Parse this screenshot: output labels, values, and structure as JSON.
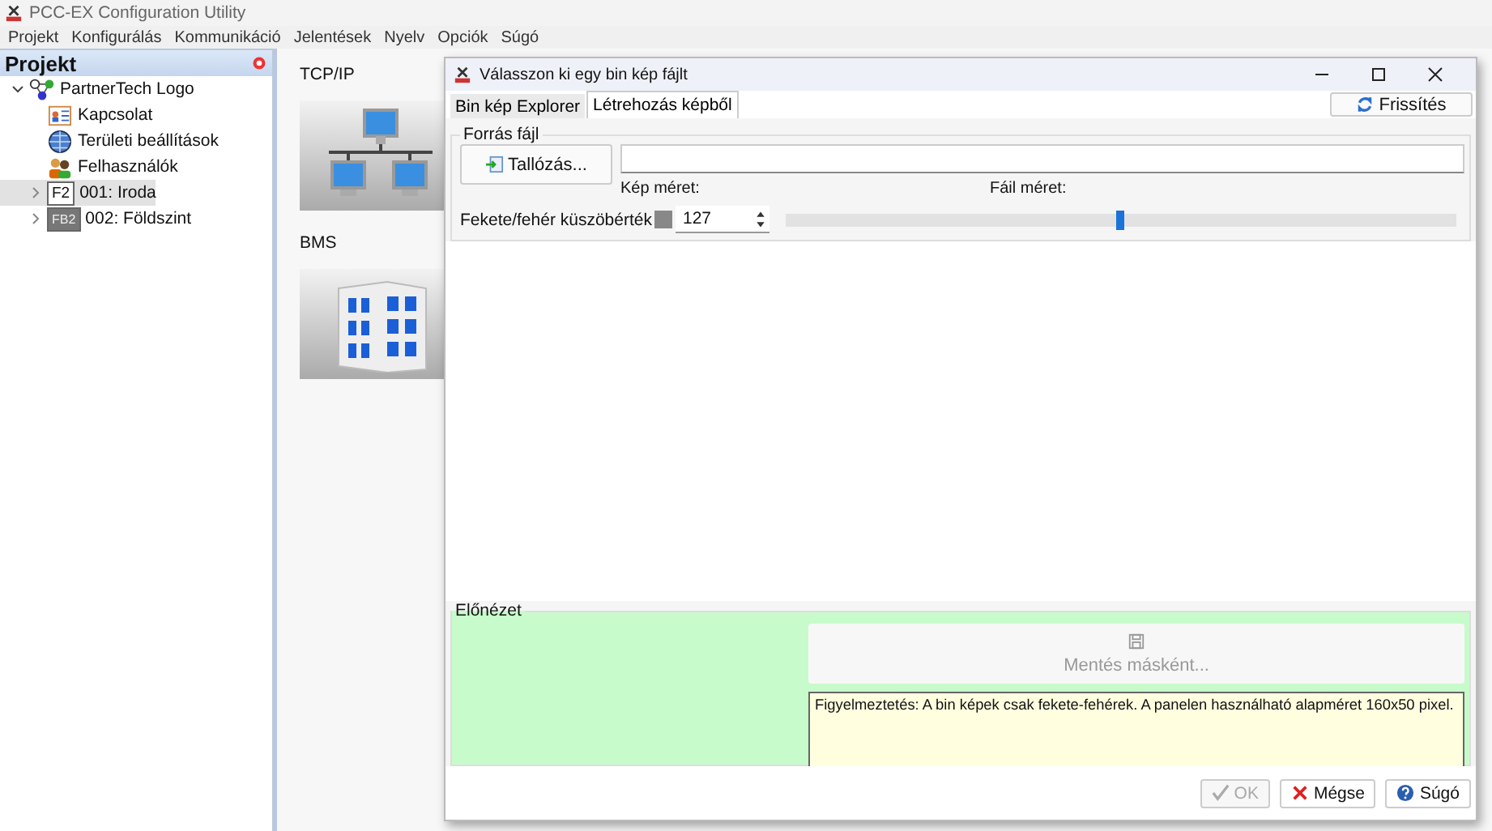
{
  "window": {
    "title": "PCC-EX Configuration Utility"
  },
  "menu": [
    "Projekt",
    "Konfigurálás",
    "Kommunikáció",
    "Jelentések",
    "Nyelv",
    "Opciók",
    "Súgó"
  ],
  "sidebar": {
    "title": "Projekt",
    "tree": [
      {
        "label": "PartnerTech Logo",
        "kind": "project",
        "expanded": true,
        "selected": false,
        "children": [
          {
            "label": "Kapcsolat",
            "kind": "contact",
            "selected": false
          },
          {
            "label": "Területi beállítások",
            "kind": "globe",
            "selected": false
          },
          {
            "label": "Felhasználók",
            "kind": "users",
            "selected": false
          },
          {
            "label": "001: Iroda",
            "kind": "floor",
            "badge": "F2",
            "expanded": false,
            "selected": true
          },
          {
            "label": "002: Földszint",
            "kind": "floor-dark",
            "badge": "FB2",
            "expanded": false,
            "selected": false
          }
        ]
      }
    ]
  },
  "modules": [
    {
      "label": "TCP/IP",
      "kind": "network"
    },
    {
      "label": "BMS",
      "kind": "building"
    }
  ],
  "dialog": {
    "title": "Válasszon ki egy bin kép fájlt",
    "tabs": [
      {
        "label": "Bin kép Explorer",
        "selected": false
      },
      {
        "label": "Létrehozás képből",
        "selected": true
      }
    ],
    "refresh_button": "Frissítés",
    "source_group": {
      "title": "Forrás fájl",
      "browse_button": "Tallózás...",
      "image_size_label": "Kép méret:",
      "file_size_label": "Fáil méret:",
      "threshold_label": "Fekete/fehér küszöbérték",
      "threshold_value": "127",
      "threshold_slider": {
        "level": 0.5
      }
    },
    "preview": {
      "title": "Előnézet",
      "save_button": {
        "label": "Mentés másként...",
        "disabled": true
      },
      "warning": "Figyelmeztetés: A bin képek csak fekete-fehérek. A panelen használható alapméret 160x50 pixel."
    },
    "buttons": [
      {
        "label": "OK",
        "kind": "ok",
        "disabled": true
      },
      {
        "label": "Mégse",
        "kind": "cancel",
        "disabled": false
      },
      {
        "label": "Súgó",
        "kind": "help",
        "disabled": false
      }
    ]
  }
}
